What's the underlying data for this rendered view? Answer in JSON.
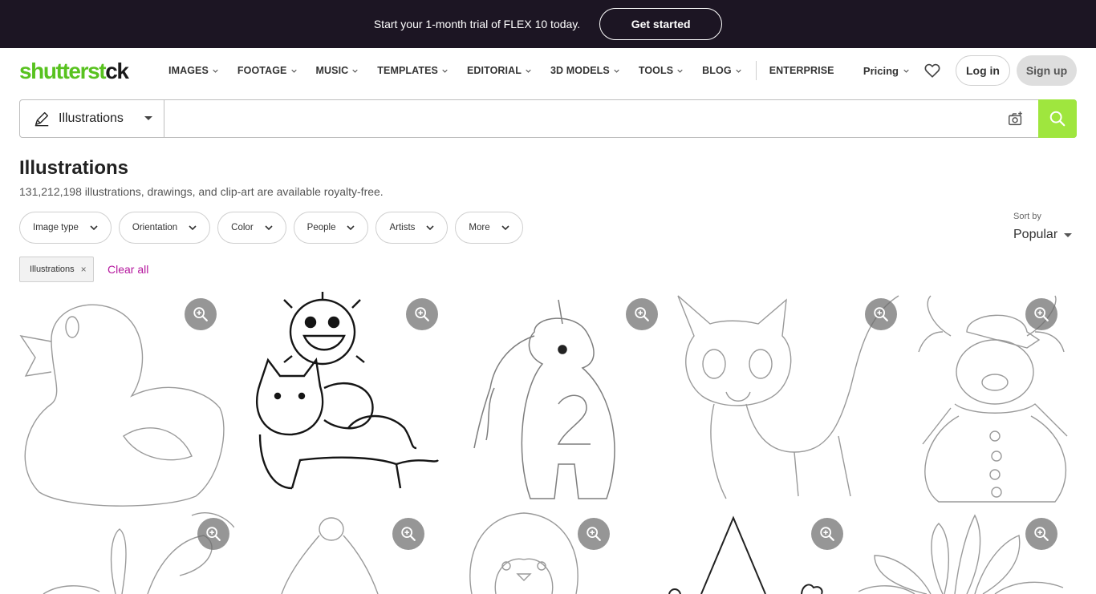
{
  "promo": {
    "text": "Start your 1-month trial of FLEX 10 today.",
    "cta_label": "Get started"
  },
  "brand": {
    "logo_text_a": "shutterst",
    "logo_text_b": "ck",
    "accent_color": "#58c21f",
    "search_button_color": "#9fe63e",
    "link_color": "#b5179e"
  },
  "nav": {
    "items": [
      {
        "label": "IMAGES"
      },
      {
        "label": "FOOTAGE"
      },
      {
        "label": "MUSIC"
      },
      {
        "label": "TEMPLATES"
      },
      {
        "label": "EDITORIAL"
      },
      {
        "label": "3D MODELS"
      },
      {
        "label": "TOOLS"
      },
      {
        "label": "BLOG"
      }
    ],
    "enterprise_label": "ENTERPRISE",
    "pricing_label": "Pricing",
    "favorites_icon": "heart-icon",
    "login_label": "Log in",
    "signup_label": "Sign up"
  },
  "search": {
    "type_label": "Illustrations",
    "type_icon": "pen-icon",
    "input_value": "",
    "placeholder": "",
    "camera_icon": "camera-search-icon",
    "search_icon": "magnifier-icon"
  },
  "page": {
    "title": "Illustrations",
    "subtitle": "131,212,198 illustrations, drawings, and clip-art are available royalty-free."
  },
  "filters": [
    {
      "label": "Image type"
    },
    {
      "label": "Orientation"
    },
    {
      "label": "Color"
    },
    {
      "label": "People"
    },
    {
      "label": "Artists"
    },
    {
      "label": "More"
    }
  ],
  "sort": {
    "label": "Sort by",
    "value": "Popular"
  },
  "active_chips": [
    {
      "label": "Illustrations",
      "remove_glyph": "×"
    }
  ],
  "clear_all_label": "Clear all",
  "results": [
    {
      "subject": "duck-outline"
    },
    {
      "subject": "monster-riding-cats"
    },
    {
      "subject": "unicorn-number-two"
    },
    {
      "subject": "kitten-outline"
    },
    {
      "subject": "reindeer-snowman"
    },
    {
      "subject": "plant-outline"
    },
    {
      "subject": "santa-hat-outline"
    },
    {
      "subject": "penguin-outline"
    },
    {
      "subject": "gnome-hat-outline"
    },
    {
      "subject": "flower-outline"
    }
  ]
}
